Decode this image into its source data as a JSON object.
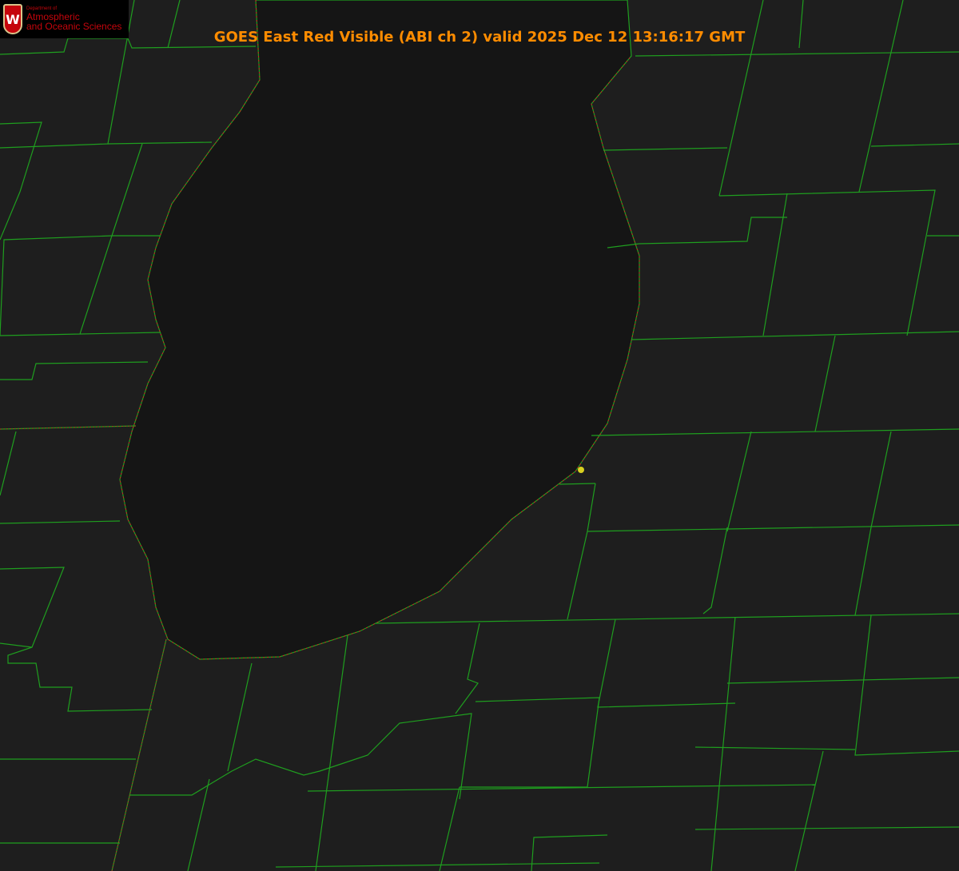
{
  "title": "GOES East Red Visible (ABI ch 2) valid 2025 Dec 12 13:16:17 GMT",
  "logo": {
    "line1": "Department of",
    "line2": "Atmospheric",
    "line3": "and Oceanic Sciences",
    "shield_letter": "W"
  },
  "colors": {
    "county_lines": "#1f9e1f",
    "shoreline": "#d02020",
    "title": "#ff8c00",
    "marker": "#d8d020",
    "lake": "#151515",
    "land": "#1e1e1e"
  }
}
